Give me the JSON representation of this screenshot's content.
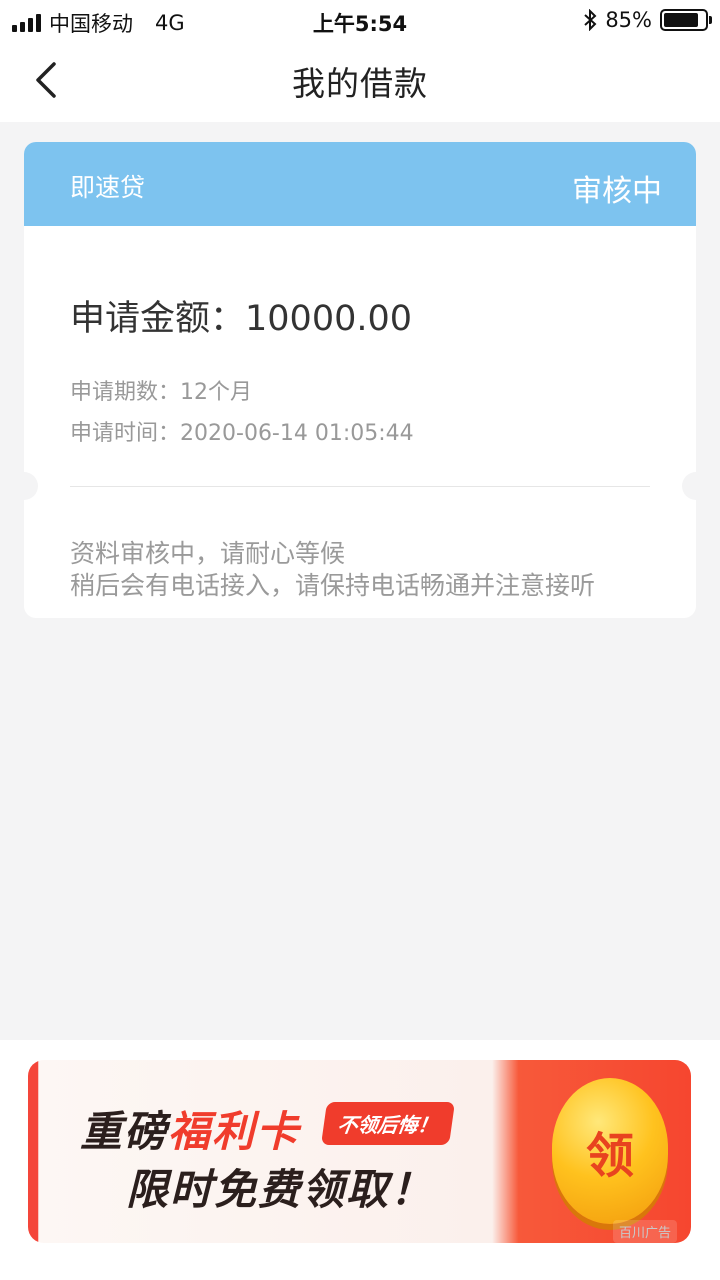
{
  "status_bar": {
    "carrier": "中国移动",
    "network": "4G",
    "time": "上午5:54",
    "bluetooth_icon": "bluetooth-icon",
    "battery_percent": "85%",
    "battery_level": 0.85
  },
  "nav": {
    "title": "我的借款",
    "back_icon": "chevron-left-icon"
  },
  "loan": {
    "product": "即速贷",
    "status": "审核中",
    "amount_label": "申请金额：",
    "amount": "10000.00",
    "term_label": "申请期数：",
    "term": "12个月",
    "time_label": "申请时间：",
    "time": "2020-06-14 01:05:44",
    "note_line1": "资料审核中，请耐心等候",
    "note_line2": "稍后会有电话接入，请保持电话畅通并注意接听"
  },
  "banner": {
    "line1_prefix": "重磅",
    "line1_accent": "福利卡",
    "tag": "不领后悔！",
    "line2": "限时免费领取！",
    "button": "领",
    "ad_label": "百川广告"
  },
  "colors": {
    "header_blue": "#7dc3ef",
    "accent_red": "#f03c2c",
    "page_bg": "#f4f4f5"
  }
}
